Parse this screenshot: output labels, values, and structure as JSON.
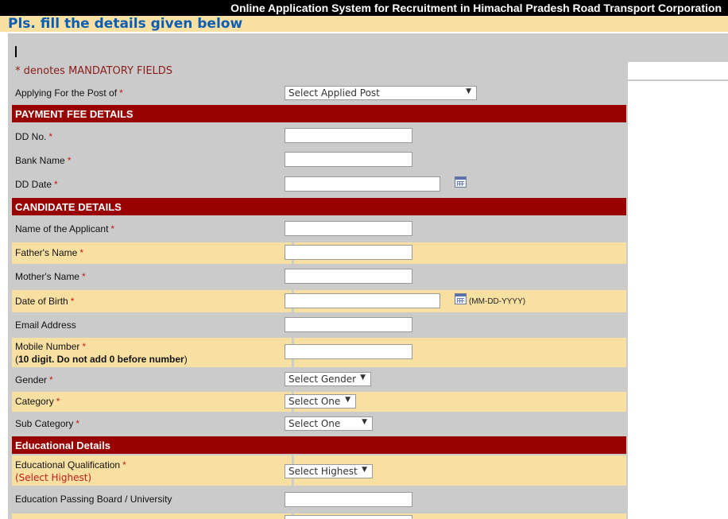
{
  "header": {
    "title": "Online Application System for Recruitment in Himachal Pradesh Road Transport Corporation",
    "subtitle": "Pls. fill the details given below"
  },
  "form": {
    "mandatory_note": "* denotes MANDATORY FIELDS",
    "required_mark": "*",
    "post": {
      "label": "Applying For the Post of",
      "selected": "Select Applied Post"
    },
    "sections": {
      "payment": "PAYMENT FEE DETAILS",
      "candidate": "CANDIDATE DETAILS",
      "education": "Educational Details"
    },
    "payment": {
      "dd_no": {
        "label": "DD No.",
        "value": ""
      },
      "bank_name": {
        "label": "Bank Name",
        "value": ""
      },
      "dd_date": {
        "label": "DD Date",
        "value": ""
      }
    },
    "candidate": {
      "name": {
        "label": "Name of the Applicant",
        "value": ""
      },
      "father": {
        "label": "Father's Name",
        "value": ""
      },
      "mother": {
        "label": "Mother's Name",
        "value": ""
      },
      "dob": {
        "label": "Date of Birth",
        "value": "",
        "hint": "(MM-DD-YYYY)"
      },
      "email": {
        "label": "Email Address",
        "value": ""
      },
      "mobile": {
        "label": "Mobile Number",
        "hint_open": "(",
        "hint_bold": "10 digit. Do not add 0 before number",
        "hint_close": ")",
        "value": ""
      },
      "gender": {
        "label": "Gender",
        "selected": "Select Gender"
      },
      "category": {
        "label": "Category",
        "selected": "Select One"
      },
      "subcategory": {
        "label": "Sub Category",
        "selected": "Select One"
      }
    },
    "education": {
      "qualification": {
        "label": "Educational Qualification",
        "hint": "(Select Highest)",
        "selected": "Select Highest"
      },
      "board": {
        "label": "Education Passing Board / University",
        "value": ""
      }
    }
  }
}
